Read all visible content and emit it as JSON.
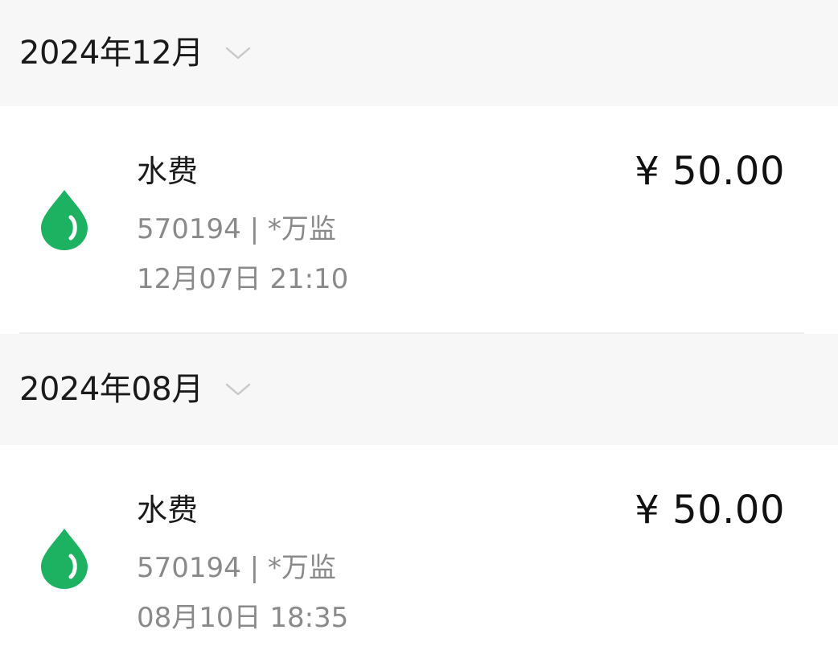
{
  "months": [
    {
      "label": "2024年12月",
      "bills": [
        {
          "title": "水费",
          "account": "570194 | *万监",
          "time": "12月07日 21:10",
          "amount": "¥ 50.00",
          "icon": "water-drop-icon"
        }
      ]
    },
    {
      "label": "2024年08月",
      "bills": [
        {
          "title": "水费",
          "account": "570194 | *万监",
          "time": "08月10日 18:35",
          "amount": "¥ 50.00",
          "icon": "water-drop-icon"
        }
      ]
    }
  ],
  "colors": {
    "accent_green": "#1db162",
    "header_bg": "#f7f7f7",
    "secondary_text": "#8a8a8a"
  }
}
